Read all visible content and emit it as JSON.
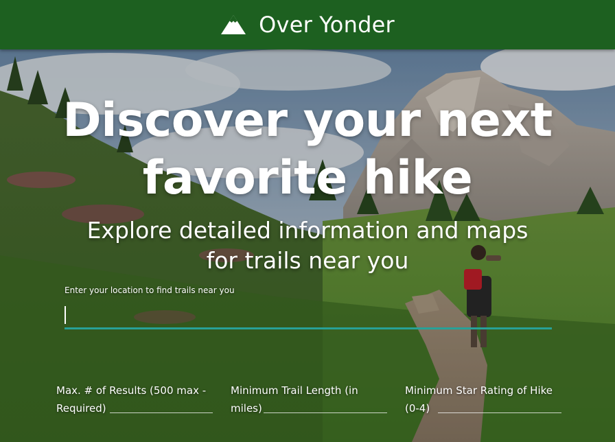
{
  "navbar": {
    "brand_icon": "mountain-icon",
    "brand_name": "Over Yonder",
    "background_color": "#1d6020"
  },
  "hero": {
    "background": "mountain-trail-photo",
    "headline_line1": "Discover your next",
    "headline_line2": "favorite hike",
    "subheadline_line1": "Explore detailed information and maps",
    "subheadline_line2": "for trails near you"
  },
  "search": {
    "location_label": "Enter your location to find trails near you",
    "location_value": "",
    "accent_color": "#27a198"
  },
  "filters": {
    "max_results_label_line1": "Max. # of Results (500 max -",
    "max_results_label_line2": "Required)",
    "min_length_label_line1": "Minimum Trail Length (in",
    "min_length_label_line2": "miles)",
    "min_stars_label_line1": "Minimum Star Rating of Hike",
    "min_stars_label_line2": "(0-4)"
  }
}
